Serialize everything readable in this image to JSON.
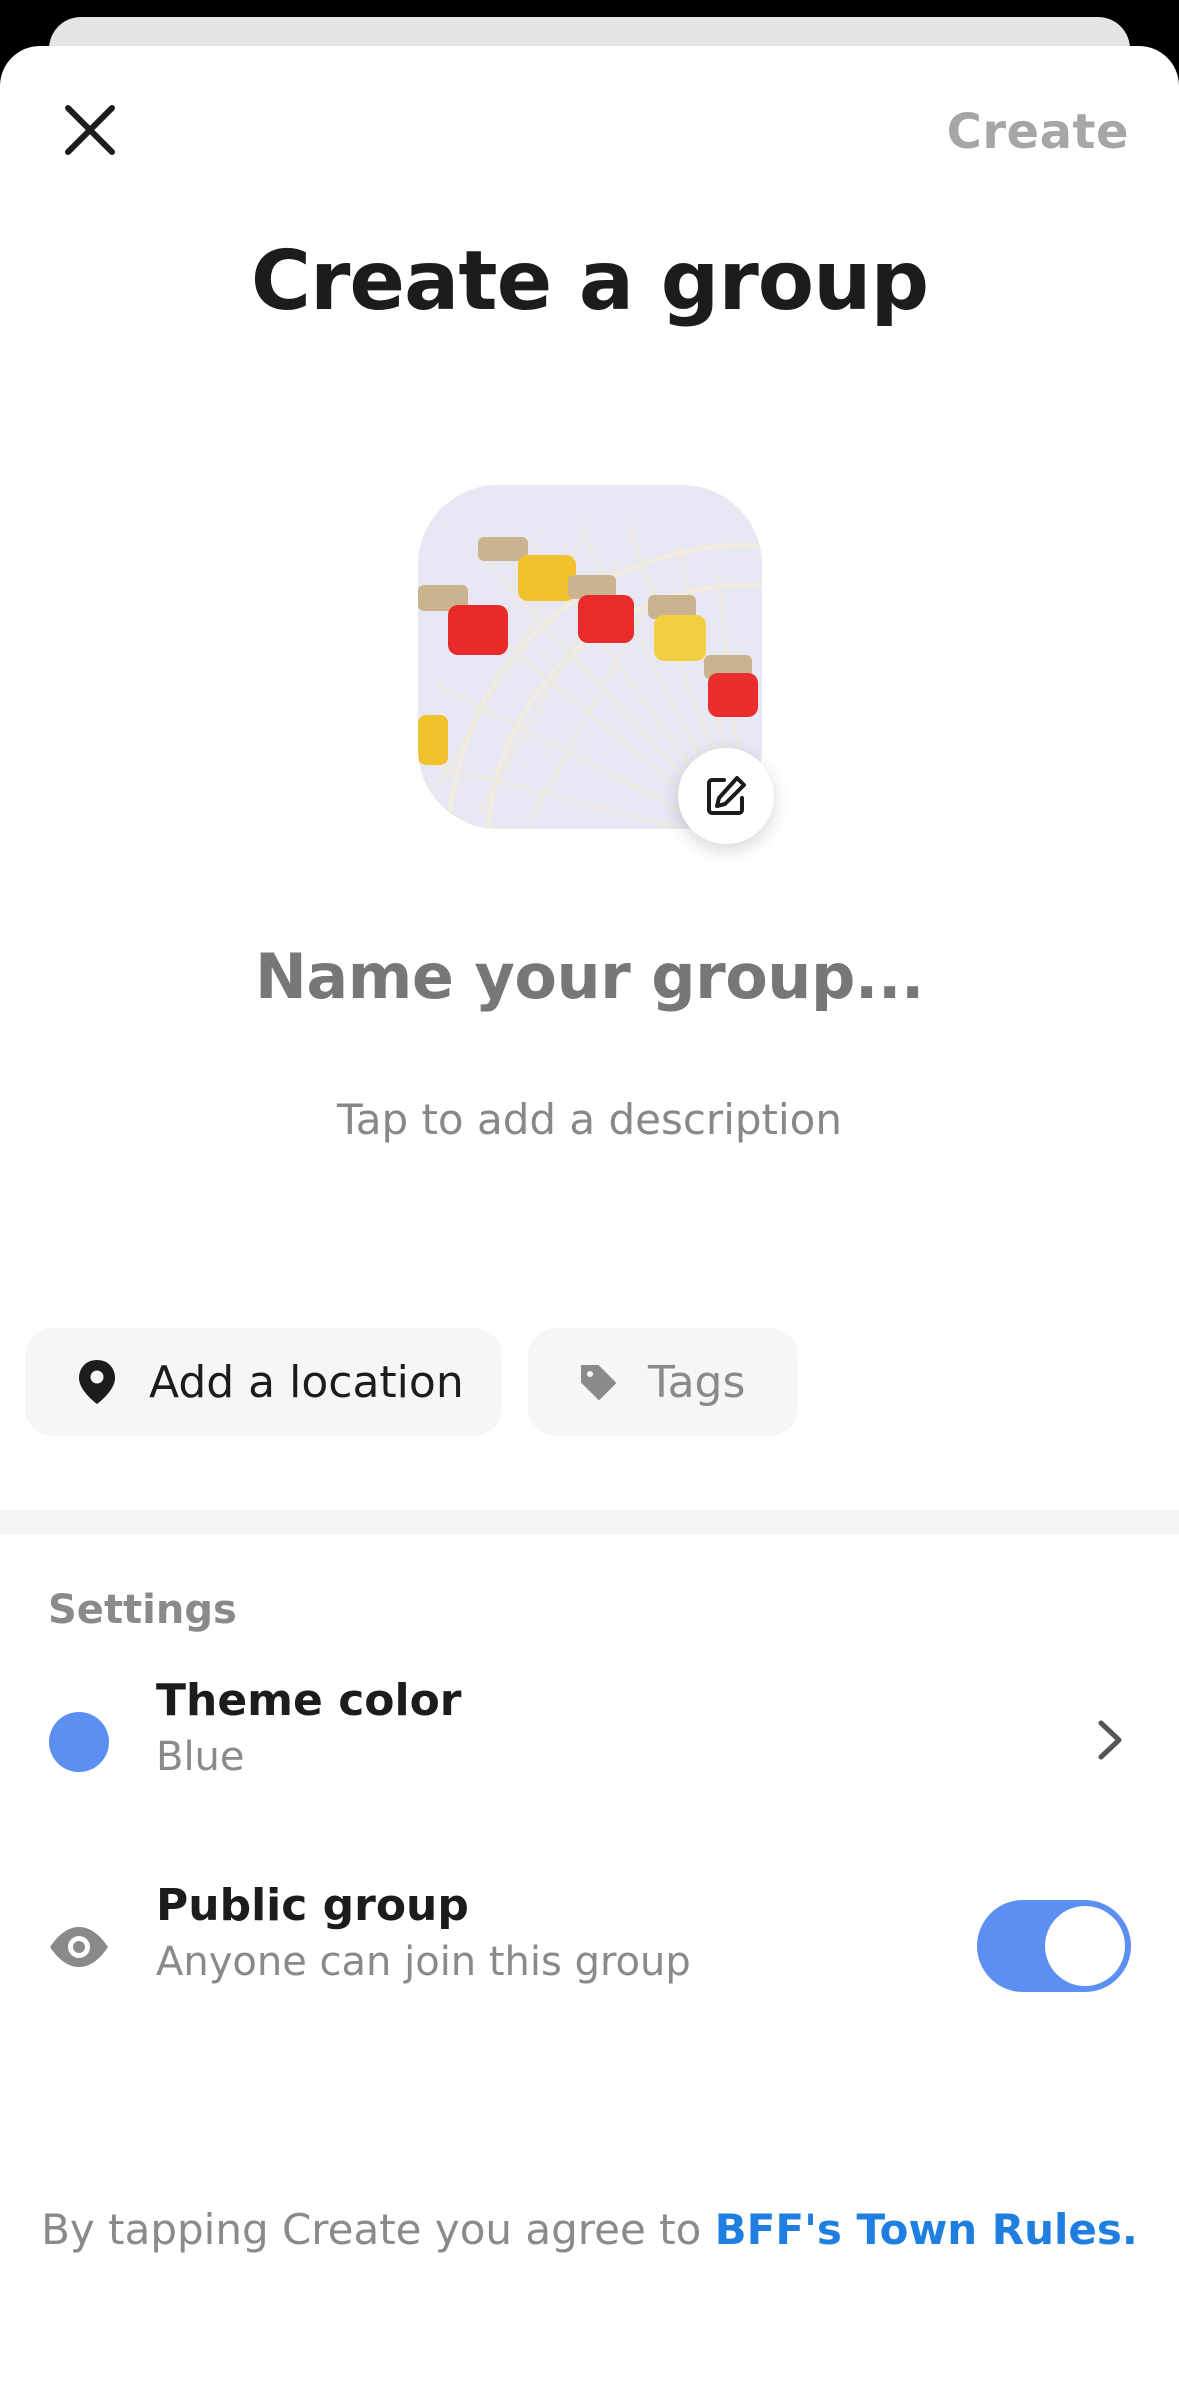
{
  "header": {
    "close_icon": "close-icon",
    "create_label": "Create"
  },
  "page": {
    "title": "Create a group"
  },
  "group_photo": {
    "edit_icon": "edit-icon"
  },
  "form": {
    "name_placeholder": "Name your group...",
    "description_placeholder": "Tap to add a description"
  },
  "chips": {
    "location": {
      "label": "Add a location",
      "icon": "location-pin-icon"
    },
    "tags": {
      "label": "Tags",
      "icon": "tag-icon"
    }
  },
  "settings": {
    "heading": "Settings",
    "theme": {
      "title": "Theme color",
      "value": "Blue",
      "color": "#5c8ff2"
    },
    "public": {
      "title": "Public group",
      "subtitle": "Anyone can join this group",
      "enabled": true
    }
  },
  "footer": {
    "text": "By tapping Create you agree to ",
    "link": "BFF's Town Rules."
  },
  "colors": {
    "accent": "#5c8ff2",
    "link": "#1f7fe0"
  }
}
